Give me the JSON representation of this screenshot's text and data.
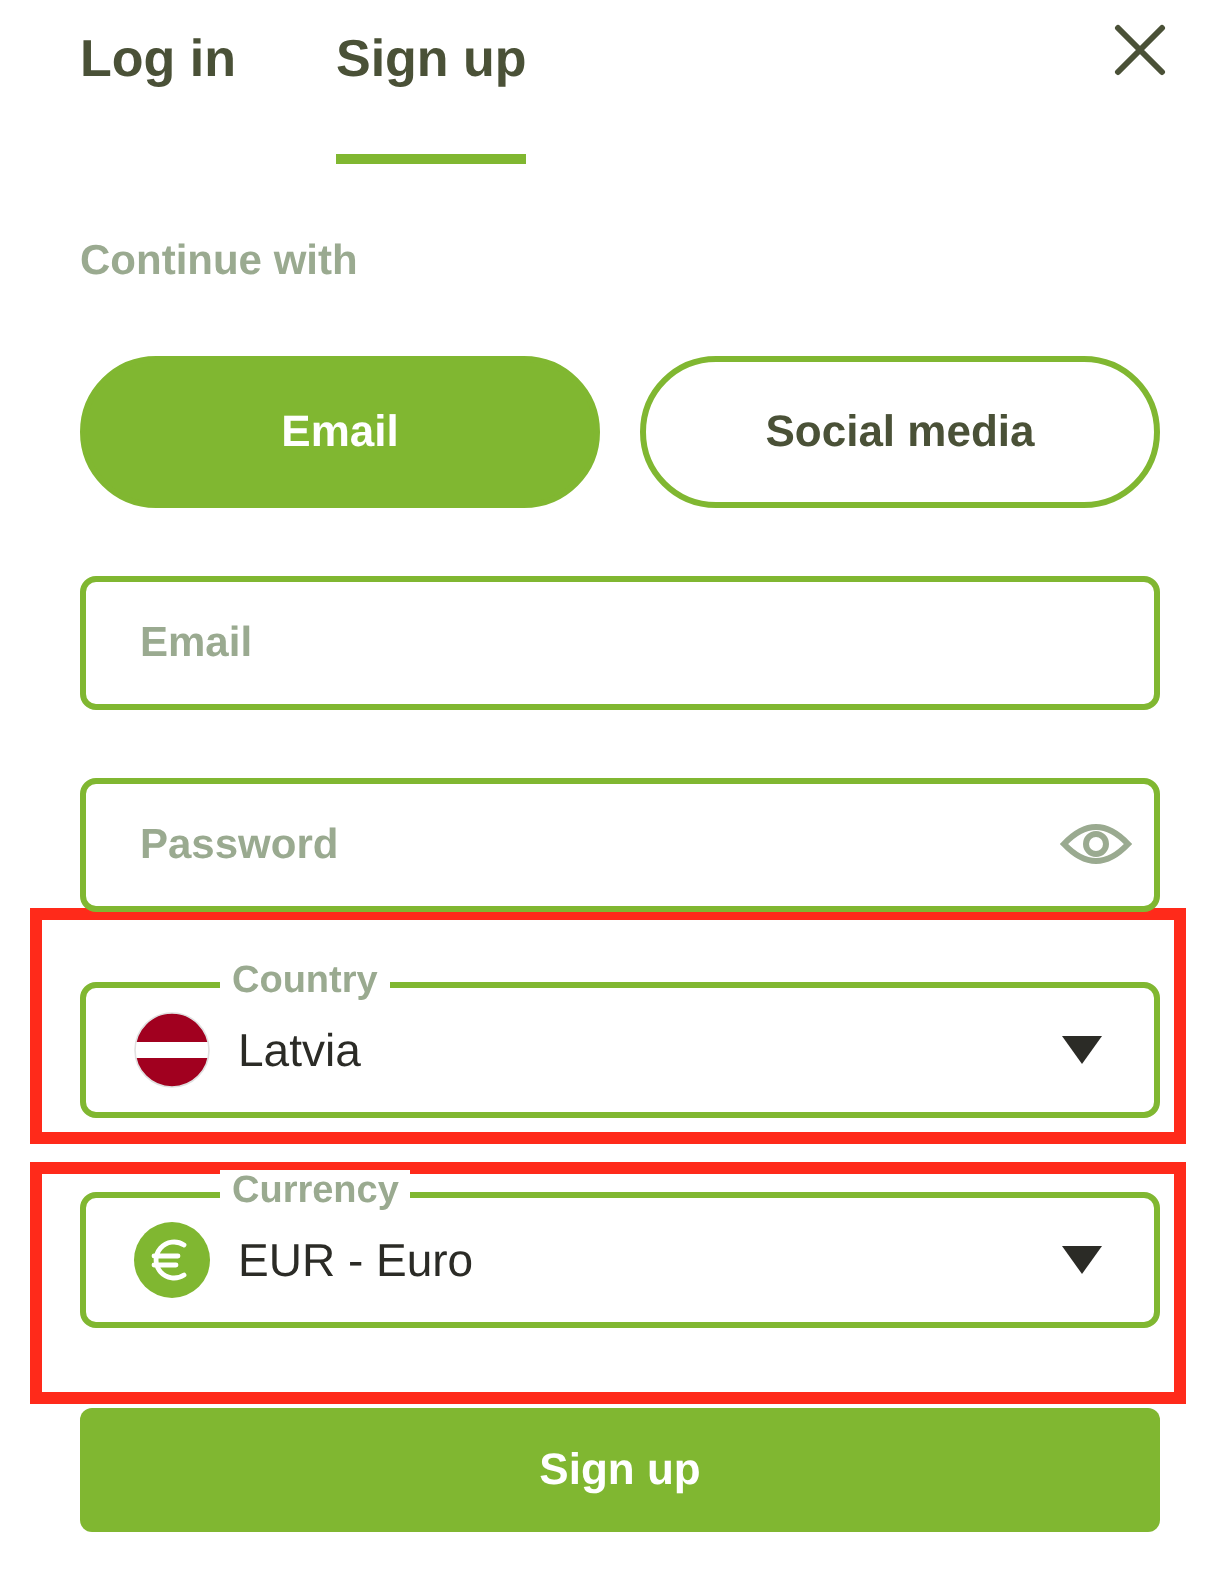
{
  "tabs": [
    {
      "label": "Log in",
      "selected": false
    },
    {
      "label": "Sign up",
      "selected": true
    }
  ],
  "continue_label": "Continue with",
  "methods": [
    {
      "label": "Email",
      "selected": true
    },
    {
      "label": "Social media",
      "selected": false
    }
  ],
  "fields": [
    {
      "kind": "text",
      "placeholder": "Email"
    },
    {
      "kind": "password",
      "placeholder": "Password"
    }
  ],
  "selects": [
    {
      "kind": "country",
      "label": "Country",
      "value": "Latvia",
      "highlighted": true
    },
    {
      "kind": "currency",
      "label": "Currency",
      "value": "EUR - Euro",
      "highlighted": true
    }
  ],
  "submit": "Sign up"
}
